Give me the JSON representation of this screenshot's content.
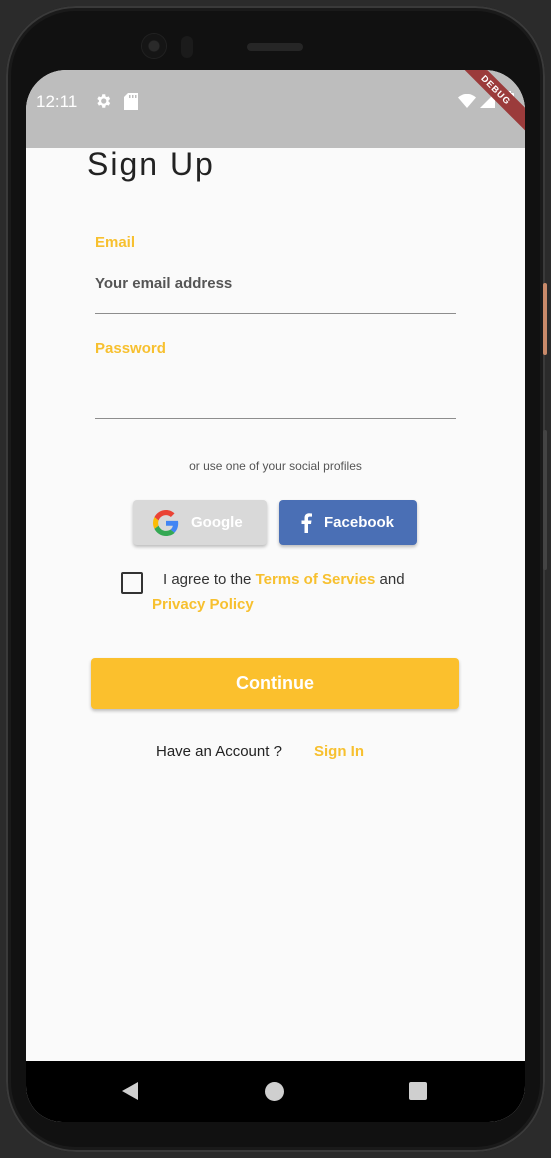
{
  "status_bar": {
    "time": "12:11",
    "icons": [
      "gear-icon",
      "sd-card-icon",
      "wifi-icon",
      "signal-icon",
      "battery-icon"
    ],
    "debug_banner": "DEBUG"
  },
  "page": {
    "title": "Sign Up"
  },
  "form": {
    "email": {
      "label": "Email",
      "placeholder": "Your email address",
      "value": ""
    },
    "password": {
      "label": "Password",
      "placeholder": "",
      "value": ""
    }
  },
  "social": {
    "caption": "or use one of your social profiles",
    "google_label": "Google",
    "facebook_label": "Facebook"
  },
  "agreement": {
    "prefix": "I agree to the ",
    "terms_link": "Terms of Servies",
    "middle": " and",
    "privacy_link": "Privacy Policy",
    "checked": false
  },
  "continue_label": "Continue",
  "footer": {
    "prompt": "Have an Account ?",
    "sign_in_link": "Sign In"
  },
  "colors": {
    "accent": "#fbc02d",
    "label": "#f7c02f",
    "facebook": "#4a6fb5",
    "google_button": "#d9d9d9",
    "status_bar": "#bdbdbd"
  },
  "nav_bar": {
    "icons": [
      "back-icon",
      "home-icon",
      "recents-icon"
    ]
  }
}
